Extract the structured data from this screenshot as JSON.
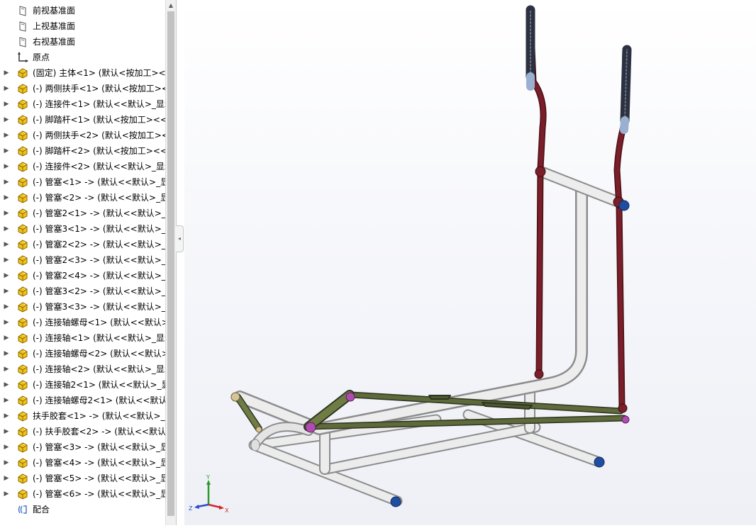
{
  "feature_tree": {
    "items": [
      {
        "label": "前视基准面",
        "icon": "plane-icon",
        "expand": false
      },
      {
        "label": "上视基准面",
        "icon": "plane-icon",
        "expand": false
      },
      {
        "label": "右视基准面",
        "icon": "plane-icon",
        "expand": false
      },
      {
        "label": "原点",
        "icon": "origin-icon",
        "expand": false
      },
      {
        "label": "(固定) 主体<1> (默认<按加工><<",
        "icon": "part-icon",
        "expand": true
      },
      {
        "label": "(-) 两侧扶手<1> (默认<按加工><",
        "icon": "part-icon",
        "expand": true
      },
      {
        "label": "(-) 连接件<1> (默认<<默认>_显示",
        "icon": "part-icon",
        "expand": true
      },
      {
        "label": "(-) 脚踏杆<1> (默认<按加工><<默",
        "icon": "part-icon",
        "expand": true
      },
      {
        "label": "(-) 两侧扶手<2> (默认<按加工><",
        "icon": "part-icon",
        "expand": true
      },
      {
        "label": "(-) 脚踏杆<2> (默认<按加工><<默",
        "icon": "part-icon",
        "expand": true
      },
      {
        "label": "(-) 连接件<2> (默认<<默认>_显示",
        "icon": "part-icon",
        "expand": true
      },
      {
        "label": "(-) 管塞<1> -> (默认<<默认>_显示",
        "icon": "part-icon",
        "expand": true
      },
      {
        "label": "(-) 管塞<2> -> (默认<<默认>_显示",
        "icon": "part-icon",
        "expand": true
      },
      {
        "label": "(-) 管塞2<1> -> (默认<<默认>_显",
        "icon": "part-icon",
        "expand": true
      },
      {
        "label": "(-) 管塞3<1> -> (默认<<默认>_显",
        "icon": "part-icon",
        "expand": true
      },
      {
        "label": "(-) 管塞2<2> -> (默认<<默认>_显",
        "icon": "part-icon",
        "expand": true
      },
      {
        "label": "(-) 管塞2<3> -> (默认<<默认>_显",
        "icon": "part-icon",
        "expand": true
      },
      {
        "label": "(-) 管塞2<4> -> (默认<<默认>_显",
        "icon": "part-icon",
        "expand": true
      },
      {
        "label": "(-) 管塞3<2> -> (默认<<默认>_显",
        "icon": "part-icon",
        "expand": true
      },
      {
        "label": "(-) 管塞3<3> -> (默认<<默认>_显",
        "icon": "part-icon",
        "expand": true
      },
      {
        "label": "(-) 连接轴螺母<1> (默认<<默认>_",
        "icon": "part-icon",
        "expand": true
      },
      {
        "label": "(-) 连接轴<1> (默认<<默认>_显示",
        "icon": "part-icon",
        "expand": true
      },
      {
        "label": "(-) 连接轴螺母<2> (默认<<默认>_",
        "icon": "part-icon",
        "expand": true
      },
      {
        "label": "(-) 连接轴<2> (默认<<默认>_显示",
        "icon": "part-icon",
        "expand": true
      },
      {
        "label": "(-) 连接轴2<1> (默认<<默认>_显",
        "icon": "part-icon",
        "expand": true
      },
      {
        "label": "(-) 连接轴螺母2<1> (默认<<默认>",
        "icon": "part-icon",
        "expand": true
      },
      {
        "label": "扶手胶套<1> -> (默认<<默认>_显",
        "icon": "part-icon",
        "expand": true
      },
      {
        "label": "(-) 扶手胶套<2> -> (默认<<默认>",
        "icon": "part-icon",
        "expand": true
      },
      {
        "label": "(-) 管塞<3> -> (默认<<默认>_显示",
        "icon": "part-icon",
        "expand": true
      },
      {
        "label": "(-) 管塞<4> -> (默认<<默认>_显示",
        "icon": "part-icon",
        "expand": true
      },
      {
        "label": "(-) 管塞<5> -> (默认<<默认>_显示",
        "icon": "part-icon",
        "expand": true
      },
      {
        "label": "(-) 管塞<6> -> (默认<<默认>_显示",
        "icon": "part-icon",
        "expand": true
      },
      {
        "label": "配合",
        "icon": "mates-icon",
        "expand": false
      }
    ]
  },
  "triad": {
    "x_label": "X",
    "y_label": "Y",
    "z_label": "Z"
  },
  "colors": {
    "frame": "#e6e6e6",
    "handle": "#7a1f2a",
    "link": "#5e6a3a",
    "cap": "#1f4ea0",
    "grip": "#2b3140",
    "accent": "#b04cb0"
  }
}
